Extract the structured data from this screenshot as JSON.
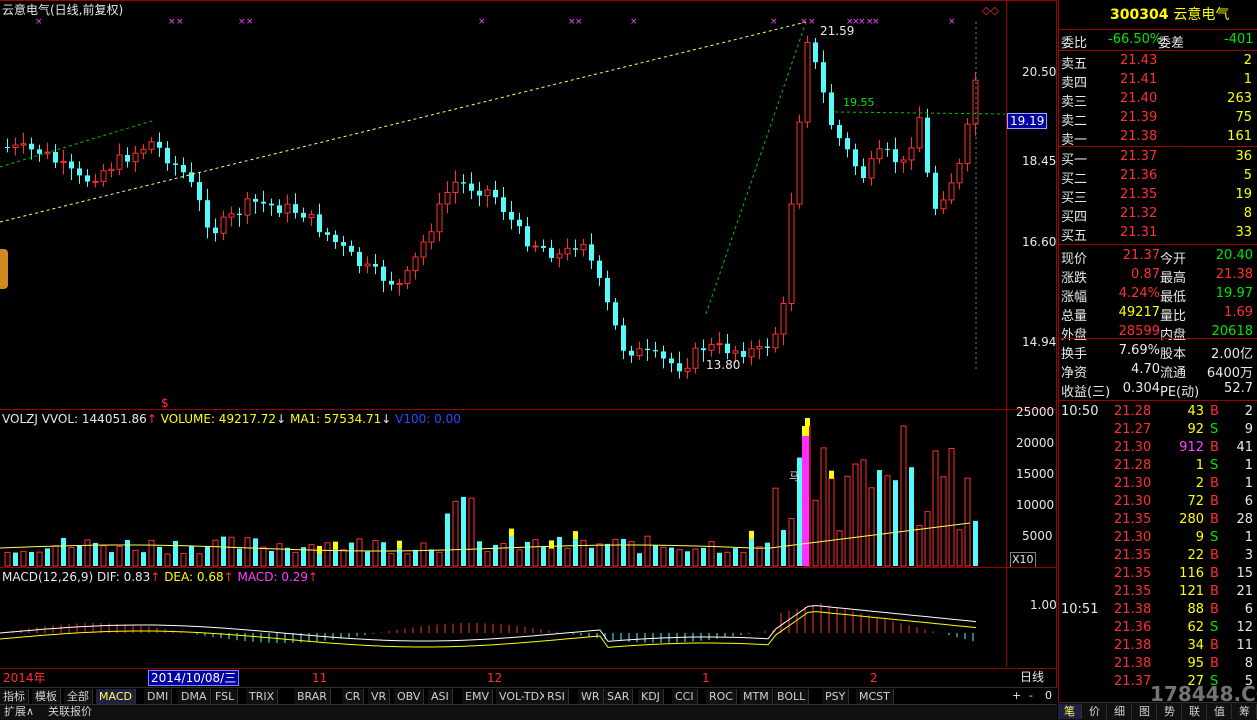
{
  "chart_title": "云意电气(日线,前复权)",
  "price_levels": [
    "20.50",
    "18.45",
    "16.60",
    "14.94"
  ],
  "current_price_tag": "19.19",
  "annotations": {
    "high": "21.59",
    "low": "13.80",
    "dotted_level": "19.55",
    "marker": "$"
  },
  "vol_header": {
    "name": "VOLZJ",
    "vvol": "VVOL: 144051.86",
    "volume": "VOLUME: 49217.72",
    "ma1": "MA1: 57534.71",
    "v100": "V100: 0.00"
  },
  "vol_levels": [
    "25000",
    "20000",
    "15000",
    "10000",
    "5000"
  ],
  "vol_unit": "X10",
  "vol_mark": "马",
  "macd_header": {
    "name": "MACD(12,26,9)",
    "dif": "DIF: 0.83",
    "dea": "DEA: 0.68",
    "macd": "MACD: 0.29"
  },
  "macd_level": "1.00",
  "time_axis": [
    "2014年",
    "2014/10/08/三",
    "11",
    "12",
    "1",
    "2"
  ],
  "period": "日线",
  "zoom_controls": [
    "+",
    "-",
    "0"
  ],
  "tabs": [
    "指标",
    "模板",
    "全部",
    "MACD",
    "DMI",
    "DMA",
    "FSL",
    "TRIX",
    "BRAR",
    "CR",
    "VR",
    "OBV",
    "ASI",
    "EMV",
    "VOL-TDX",
    "RSI",
    "WR",
    "SAR",
    "KDJ",
    "CCI",
    "ROC",
    "MTM",
    "BOLL",
    "PSY",
    "MCST"
  ],
  "bottom_links": [
    "扩展∧",
    "关联报价"
  ],
  "stock": {
    "code": "300304",
    "name": "云意电气"
  },
  "ratio": {
    "label1": "委比",
    "val1": "-66.50%",
    "label2": "委差",
    "val2": "-401"
  },
  "asks": [
    {
      "label": "卖五",
      "price": "21.43",
      "vol": "2"
    },
    {
      "label": "卖四",
      "price": "21.41",
      "vol": "1"
    },
    {
      "label": "卖三",
      "price": "21.40",
      "vol": "263"
    },
    {
      "label": "卖二",
      "price": "21.39",
      "vol": "75"
    },
    {
      "label": "卖一",
      "price": "21.38",
      "vol": "161"
    }
  ],
  "bids": [
    {
      "label": "买一",
      "price": "21.37",
      "vol": "36"
    },
    {
      "label": "买二",
      "price": "21.36",
      "vol": "5"
    },
    {
      "label": "买三",
      "price": "21.35",
      "vol": "19"
    },
    {
      "label": "买四",
      "price": "21.32",
      "vol": "8"
    },
    {
      "label": "买五",
      "price": "21.31",
      "vol": "33"
    }
  ],
  "quote": [
    {
      "l1": "现价",
      "v1": "21.37",
      "l2": "今开",
      "v2": "20.40"
    },
    {
      "l1": "涨跌",
      "v1": "0.87",
      "l2": "最高",
      "v2": "21.38"
    },
    {
      "l1": "涨幅",
      "v1": "4.24%",
      "l2": "最低",
      "v2": "19.97"
    },
    {
      "l1": "总量",
      "v1": "49217",
      "l2": "量比",
      "v2": "1.69"
    },
    {
      "l1": "外盘",
      "v1": "28599",
      "l2": "内盘",
      "v2": "20618"
    }
  ],
  "fund": [
    {
      "l1": "换手",
      "v1": "7.69%",
      "l2": "股本",
      "v2": "2.00亿"
    },
    {
      "l1": "净资",
      "v1": "4.70",
      "l2": "流通",
      "v2": "6400万"
    },
    {
      "l1": "收益(三)",
      "v1": "0.304",
      "l2": "PE(动)",
      "v2": "52.7"
    }
  ],
  "ticks": [
    {
      "time": "10:50",
      "price": "21.28",
      "vol": "43",
      "bs": "B",
      "n": "2"
    },
    {
      "time": "",
      "price": "21.27",
      "vol": "92",
      "bs": "S",
      "n": "9"
    },
    {
      "time": "",
      "price": "21.30",
      "vol": "912",
      "bs": "B",
      "n": "41"
    },
    {
      "time": "",
      "price": "21.28",
      "vol": "1",
      "bs": "S",
      "n": "1"
    },
    {
      "time": "",
      "price": "21.30",
      "vol": "2",
      "bs": "B",
      "n": "1"
    },
    {
      "time": "",
      "price": "21.30",
      "vol": "72",
      "bs": "B",
      "n": "6"
    },
    {
      "time": "",
      "price": "21.35",
      "vol": "280",
      "bs": "B",
      "n": "28"
    },
    {
      "time": "",
      "price": "21.30",
      "vol": "9",
      "bs": "S",
      "n": "1"
    },
    {
      "time": "",
      "price": "21.35",
      "vol": "22",
      "bs": "B",
      "n": "3"
    },
    {
      "time": "",
      "price": "21.35",
      "vol": "116",
      "bs": "B",
      "n": "15"
    },
    {
      "time": "",
      "price": "21.35",
      "vol": "121",
      "bs": "B",
      "n": "21"
    },
    {
      "time": "10:51",
      "price": "21.38",
      "vol": "88",
      "bs": "B",
      "n": "6"
    },
    {
      "time": "",
      "price": "21.36",
      "vol": "62",
      "bs": "S",
      "n": "12"
    },
    {
      "time": "",
      "price": "21.38",
      "vol": "34",
      "bs": "B",
      "n": "11"
    },
    {
      "time": "",
      "price": "21.38",
      "vol": "95",
      "bs": "B",
      "n": "8"
    },
    {
      "time": "",
      "price": "21.37",
      "vol": "27",
      "bs": "S",
      "n": "5"
    }
  ],
  "bottom_tabs": [
    "笔",
    "价",
    "细",
    "图",
    "势",
    "联",
    "值",
    "筹"
  ],
  "watermark": "178448.COM",
  "colors": {
    "up": "#ff3030",
    "down": "#54fcfc",
    "dif": "#ffffff",
    "dea": "#ffff00",
    "frame": "#a00000"
  }
}
